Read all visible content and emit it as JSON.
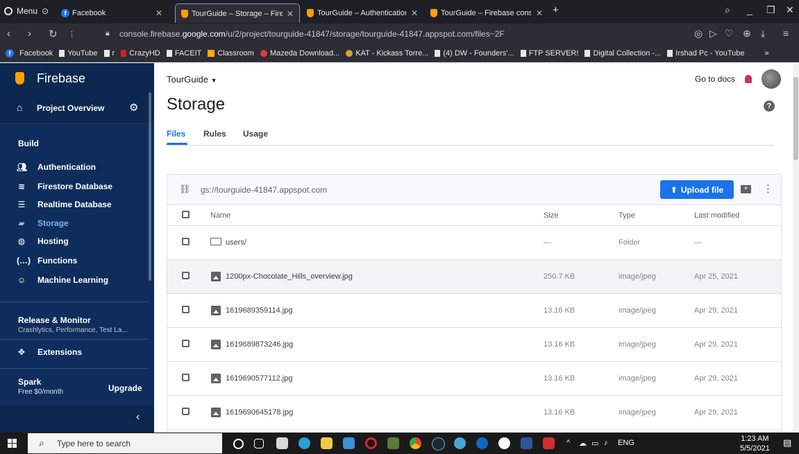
{
  "browser": {
    "menu_label": "Menu",
    "tabs": [
      {
        "title": "Facebook"
      },
      {
        "title": "TourGuide – Storage – Fireb"
      },
      {
        "title": "TourGuide – Authentication"
      },
      {
        "title": "TourGuide – Firebase consol"
      }
    ],
    "new_tab": "+",
    "url_prefix": "console.firebase.",
    "url_domain": "google.com",
    "url_path": "/u/2/project/tourguide-41847/storage/tourguide-41847.appspot.com/files~2F",
    "bookmarks": [
      "Facebook",
      "YouTube",
      "r",
      "CrazyHD",
      "FACEIT",
      "Classroom",
      "Mazeda Download...",
      "KAT - Kickass Torre...",
      "(4) DW - Founders'...",
      "FTP SERVER!",
      "Digital Collection -...",
      "Irshad Pc - YouTube"
    ],
    "more_bookmarks": "»"
  },
  "sidebar": {
    "brand": "Firebase",
    "project_overview": "Project Overview",
    "build_title": "Build",
    "build_items": [
      {
        "label": "Authentication",
        "icon": "people-icon"
      },
      {
        "label": "Firestore Database",
        "icon": "firestore-icon"
      },
      {
        "label": "Realtime Database",
        "icon": "database-icon"
      },
      {
        "label": "Storage",
        "icon": "image-icon"
      },
      {
        "label": "Hosting",
        "icon": "globe-icon"
      },
      {
        "label": "Functions",
        "icon": "braces-icon"
      },
      {
        "label": "Machine Learning",
        "icon": "robot-icon"
      }
    ],
    "release_title": "Release & Monitor",
    "release_sub": "Crashlytics, Performance, Test La...",
    "extensions": "Extensions",
    "plan_name": "Spark",
    "plan_sub": "Free $0/month",
    "upgrade": "Upgrade",
    "collapse": "‹"
  },
  "main": {
    "project": "TourGuide",
    "go_to_docs": "Go to docs",
    "title": "Storage",
    "tabs": [
      "Files",
      "Rules",
      "Usage"
    ],
    "bucket": "gs://tourguide-41847.appspot.com",
    "upload": "Upload file",
    "columns": {
      "name": "Name",
      "size": "Size",
      "type": "Type",
      "modified": "Last modified"
    },
    "rows": [
      {
        "name": "users/",
        "size": "—",
        "type": "Folder",
        "modified": "—"
      },
      {
        "name": "1200px-Chocolate_Hills_overview.jpg",
        "size": "250.7 KB",
        "type": "image/jpeg",
        "modified": "Apr 25, 2021"
      },
      {
        "name": "1619689359114.jpg",
        "size": "13.16 KB",
        "type": "image/jpeg",
        "modified": "Apr 29, 2021"
      },
      {
        "name": "1619689873246.jpg",
        "size": "13.16 KB",
        "type": "image/jpeg",
        "modified": "Apr 29, 2021"
      },
      {
        "name": "1619690577112.jpg",
        "size": "13.16 KB",
        "type": "image/jpeg",
        "modified": "Apr 29, 2021"
      },
      {
        "name": "1619690645178.jpg",
        "size": "13.16 KB",
        "type": "image/jpeg",
        "modified": "Apr 29, 2021"
      }
    ]
  },
  "taskbar": {
    "search_placeholder": "Type here to search",
    "lang": "ENG",
    "time": "1:23 AM",
    "date": "5/5/2021"
  },
  "colors": {
    "sidebar": "#0f2d5c",
    "accent": "#1a73e8",
    "firebase": "#ffa000"
  }
}
